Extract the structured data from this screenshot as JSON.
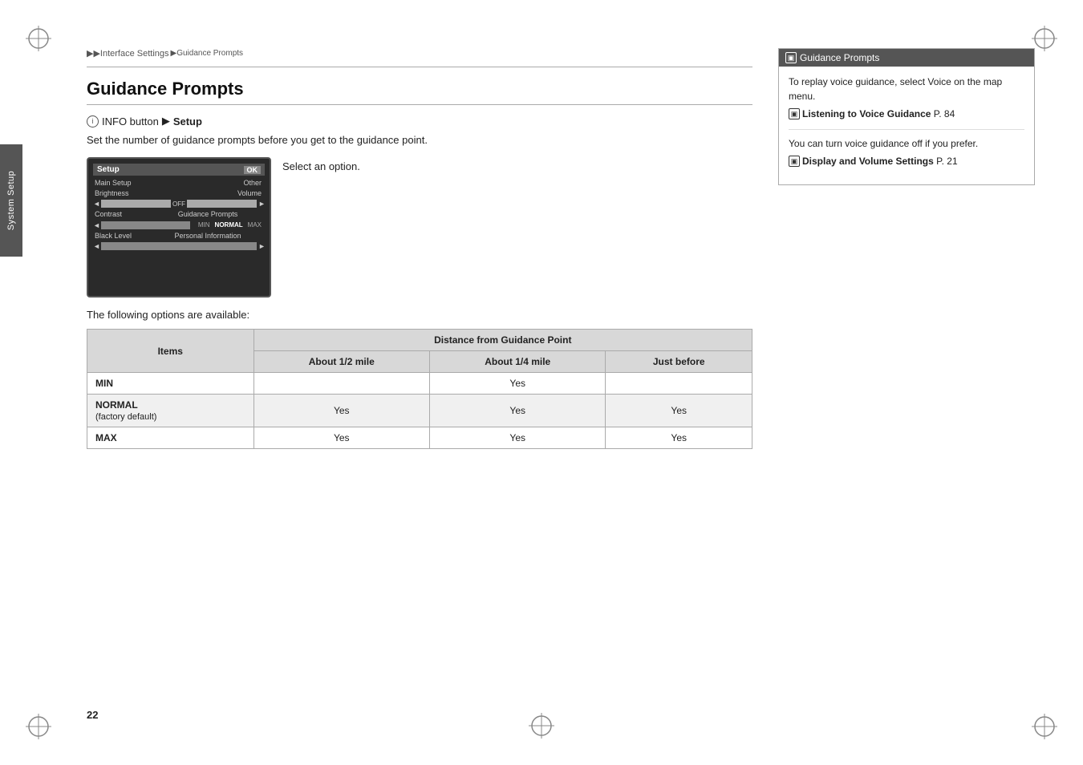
{
  "page": {
    "number": "22",
    "side_tab": "System Setup"
  },
  "breadcrumb": {
    "items": [
      "▶▶Interface Settings",
      "▶Guidance Prompts"
    ]
  },
  "title": "Guidance Prompts",
  "info_line": {
    "icon_label": "i",
    "text_before": "INFO button",
    "arrow": "▶",
    "bold_text": "Setup"
  },
  "description": "Set the number of guidance prompts before you get to the guidance point.",
  "screen": {
    "title": "Setup",
    "ok_label": "OK",
    "rows": [
      {
        "label": "Main Setup",
        "extra": "Other"
      },
      {
        "label": "Brightness",
        "extra": "Volume"
      },
      {
        "label": "Contrast",
        "has_bar": true
      },
      {
        "label": "Black Level",
        "extra": "Guidance Prompts"
      }
    ],
    "guidance_options": [
      "MIN",
      "NORMAL",
      "MAX"
    ]
  },
  "caption": "Select an option.",
  "following_text": "The following options are available:",
  "table": {
    "header_items": "Items",
    "header_distance": "Distance from Guidance Point",
    "sub_headers": [
      "About 1/2 mile",
      "About 1/4 mile",
      "Just before"
    ],
    "rows": [
      {
        "label": "MIN",
        "sub_label": "",
        "col1": "",
        "col2": "Yes",
        "col3": ""
      },
      {
        "label": "NORMAL",
        "sub_label": "(factory default)",
        "col1": "Yes",
        "col2": "Yes",
        "col3": "Yes"
      },
      {
        "label": "MAX",
        "sub_label": "",
        "col1": "Yes",
        "col2": "Yes",
        "col3": "Yes"
      }
    ]
  },
  "right_panel": {
    "header_icon": "▣",
    "header_text": "Guidance Prompts",
    "body_text1": "To replay voice guidance, select Voice on the map menu.",
    "link1": {
      "icon": "▣",
      "bold": "Listening to Voice Guidance",
      "text": " P. 84"
    },
    "body_text2": "You can turn voice guidance off if you prefer.",
    "link2": {
      "icon": "▣",
      "bold": "Display and Volume Settings",
      "text": " P. 21"
    }
  }
}
